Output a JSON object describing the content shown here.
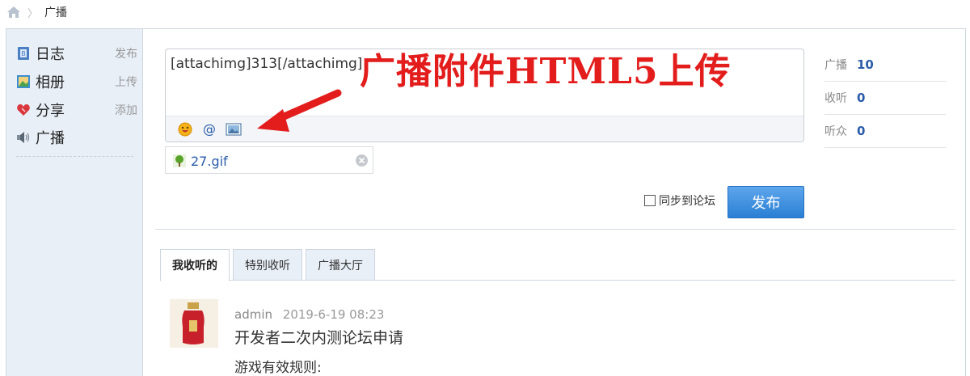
{
  "breadcrumb": {
    "current": "广播"
  },
  "sidebar": {
    "items": [
      {
        "label": "日志",
        "action": "发布",
        "icon": "blog-icon"
      },
      {
        "label": "相册",
        "action": "上传",
        "icon": "album-icon"
      },
      {
        "label": "分享",
        "action": "添加",
        "icon": "heart-icon"
      },
      {
        "label": "广播",
        "action": "",
        "icon": "speaker-icon"
      }
    ]
  },
  "composer": {
    "text": "[attachimg]313[/attachimg]",
    "toolbar": [
      "smiley-icon",
      "at-icon",
      "image-icon"
    ]
  },
  "annotation": "广播附件HTML5上传",
  "attachment": {
    "filename": "27.gif"
  },
  "sync": {
    "label": "同步到论坛",
    "checked": false
  },
  "publish": {
    "label": "发布"
  },
  "stats": [
    {
      "label": "广播",
      "value": "10"
    },
    {
      "label": "收听",
      "value": "0"
    },
    {
      "label": "听众",
      "value": "0"
    }
  ],
  "tabs": [
    {
      "label": "我收听的",
      "active": true
    },
    {
      "label": "特别收听",
      "active": false
    },
    {
      "label": "广播大厅",
      "active": false
    }
  ],
  "feed": {
    "author": "admin",
    "time": "2019-6-19 08:23",
    "title": "开发者二次内测论坛申请",
    "body": "游戏有效规则:"
  },
  "colors": {
    "accent": "#2a7fd4",
    "annotation": "#e31c1c",
    "sidebar_bg": "#e8eff7"
  }
}
